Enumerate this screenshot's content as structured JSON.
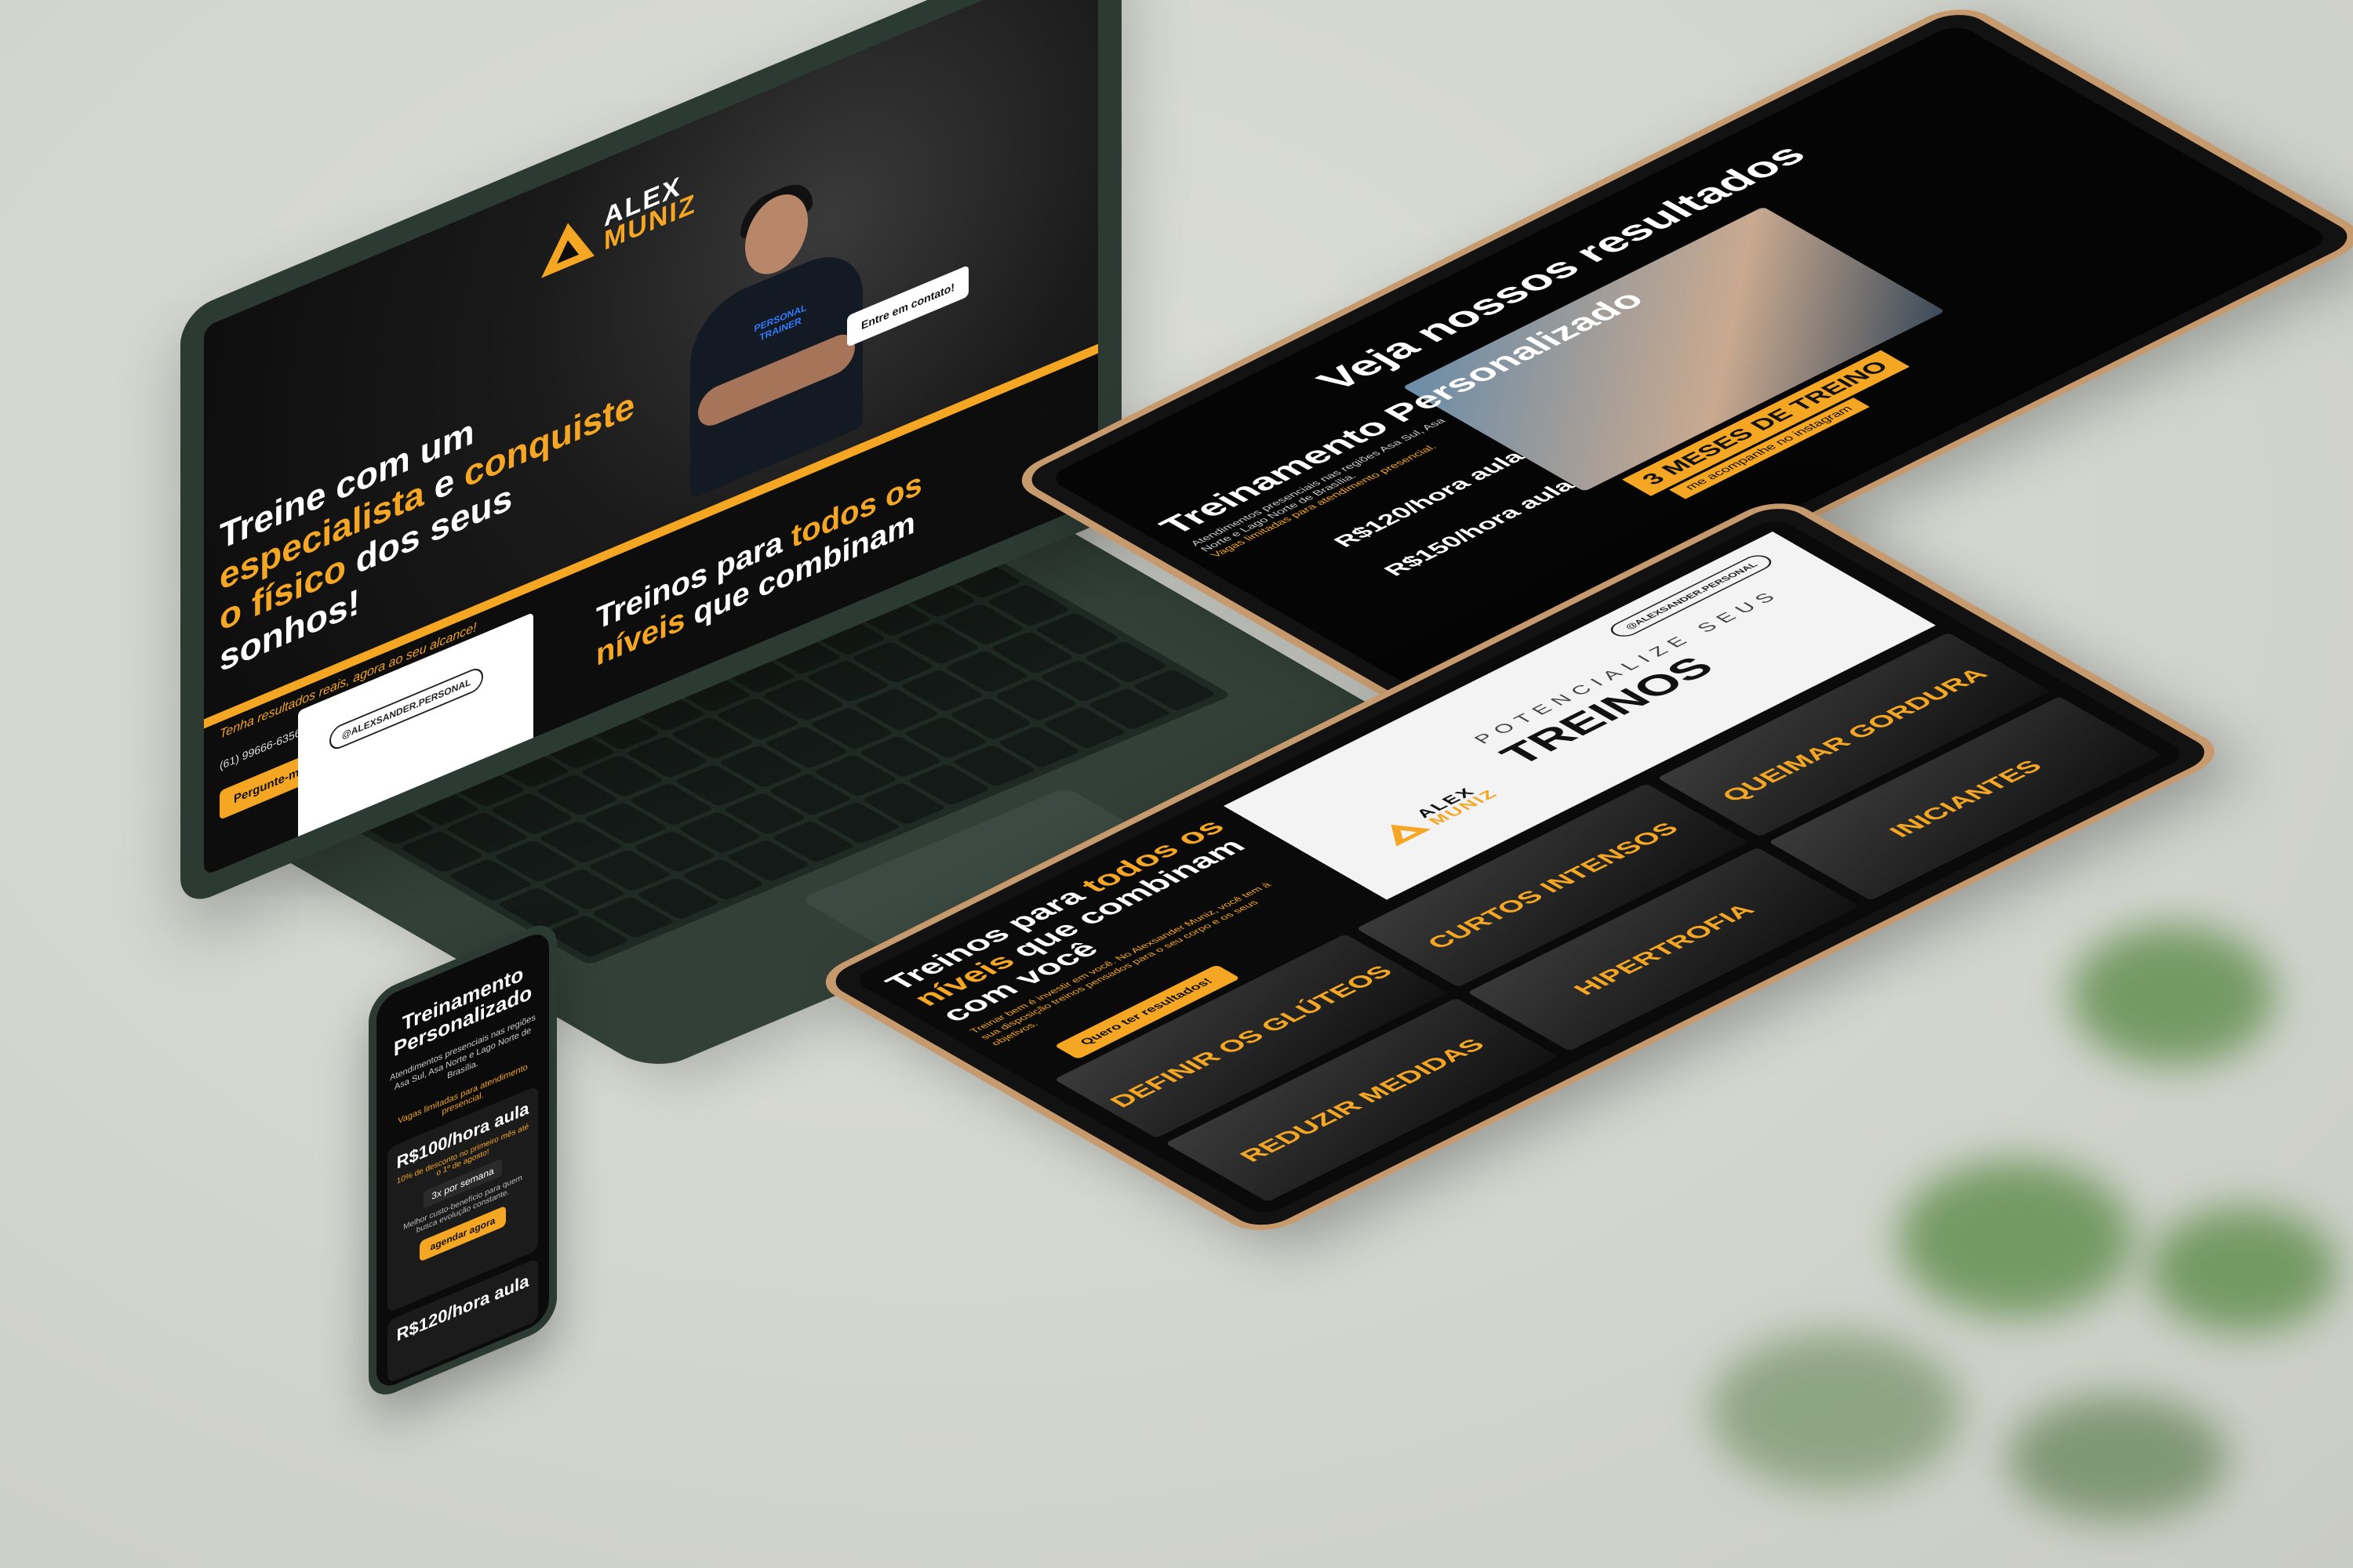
{
  "laptop": {
    "logo_line1": "ALEX",
    "logo_line2": "MUNIZ",
    "shirt_text": "PERSONAL TRAINER",
    "hero_title_a": "Treine com um ",
    "hero_title_b": "especialista",
    "hero_title_c": " e ",
    "hero_title_d": "conquiste",
    "hero_title_e": " ",
    "hero_title_f": "o físico",
    "hero_title_g": " dos seus sonhos!",
    "hero_sub": "Tenha resultados reais, agora ao seu alcance!",
    "phone": "(61) 99666-6356 - Brasília/DF",
    "cta": "Pergunte-me como!",
    "contact_button": "Entre em contato!",
    "handle": "@ALEXSANDER.PERSONAL",
    "section_title_a": "Treinos para ",
    "section_title_b": "todos os níveis",
    "section_title_c": " que combinam"
  },
  "tablet_top": {
    "results_title": "Veja nossos resultados",
    "results_caption": "3 MESES DE TREINO",
    "results_sub": "me acompanhe no instagram",
    "section_title": "Treinamento Personalizado",
    "section_sub": "Atendimentos presenciais nas regiões Asa Sul, Asa Norte e Lago Norte de Brasília.",
    "vagas": "Vagas limitadas para atendimento presencial.",
    "price_1": "R$120/hora aula",
    "price_2": "R$150/hora aula"
  },
  "tablet_bottom": {
    "handle": "@ALEXSANDER.PERSONAL",
    "potencialize": "POTENCIALIZE SEUS",
    "treinos": "TREINOS",
    "logo_line1": "ALEX",
    "logo_line2": "MUNIZ",
    "heading_a": "Treinos para ",
    "heading_b": "todos os níveis",
    "heading_c": " que combinam com você",
    "text": "Treinar bem é investir em você. No Alexsander Muniz, você tem à sua disposição treinos pensados para o seu corpo e os seus objetivos.",
    "cta": "Quero ter resultados!",
    "tiles": [
      "DEFINIR OS GLÚTEOS",
      "CURTOS INTENSOS",
      "QUEIMAR GORDURA",
      "REDUZIR MEDIDAS",
      "HIPERTROFIA",
      "INICIANTES"
    ]
  },
  "phone": {
    "title": "Treinamento Personalizado",
    "sub": "Atendimentos presenciais nas regiões Asa Sul, Asa Norte e Lago Norte de Brasília.",
    "vagas": "Vagas limitadas para atendimento presencial.",
    "price_1": "R$100/hora aula",
    "note_1": "10% de desconto no primeiro mês até o 1º de agosto!",
    "freq": "3x por semana",
    "desc": "Melhor custo-benefício para quem busca evolução constante.",
    "cta": "agendar agora",
    "price_2": "R$120/hora aula"
  },
  "colors": {
    "accent": "#f5a623",
    "screen_bg": "#0b0b0b",
    "device_green": "#2c3a34",
    "tablet_bezel": "#c79a6e"
  }
}
